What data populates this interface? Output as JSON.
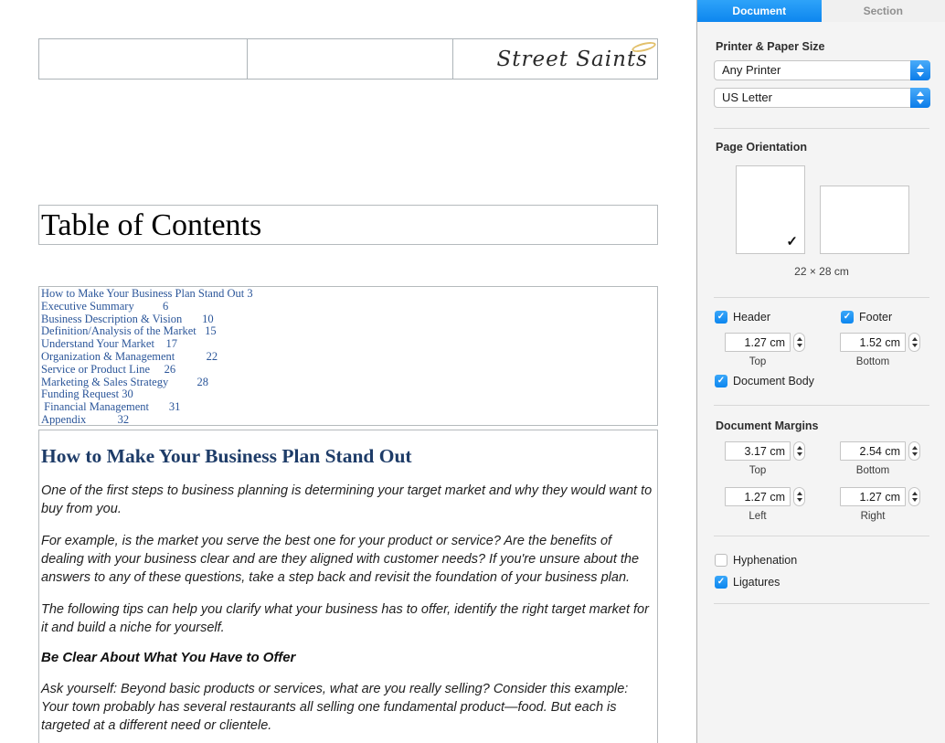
{
  "colors": {
    "accent_blue": "#1b96f5",
    "toc_link_blue": "#2a5599",
    "heading_navy": "#1e3c68",
    "halo_gold": "#e2c06b",
    "sidebar_bg": "#f4f4f4"
  },
  "document": {
    "header": {
      "logo_text": "Street Saints"
    },
    "title": "Table of Contents",
    "toc": {
      "entries": [
        {
          "title": "How to Make Your Business Plan Stand Out",
          "page": "3",
          "line": "How to Make Your Business Plan Stand Out 3"
        },
        {
          "title": "Executive Summary",
          "page": "6",
          "line": "Executive Summary          6"
        },
        {
          "title": "Business Description & Vision",
          "page": "10",
          "line": "Business Description & Vision       10"
        },
        {
          "title": "Definition/Analysis of the Market",
          "page": "15",
          "line": "Definition/Analysis of the Market   15"
        },
        {
          "title": "Understand Your Market",
          "page": "17",
          "line": "Understand Your Market    17"
        },
        {
          "title": "Organization & Management",
          "page": "22",
          "line": "Organization & Management           22"
        },
        {
          "title": "Service or Product Line",
          "page": "26",
          "line": "Service or Product Line     26"
        },
        {
          "title": "Marketing & Sales Strategy",
          "page": "28",
          "line": "Marketing & Sales Strategy          28"
        },
        {
          "title": "Funding Request",
          "page": "30",
          "line": "Funding Request 30"
        },
        {
          "title": "Financial Management",
          "page": "31",
          "line": " Financial Management       31"
        },
        {
          "title": "Appendix",
          "page": "32",
          "line": "Appendix           32"
        }
      ]
    },
    "article": {
      "heading": "How to Make Your Business Plan Stand Out",
      "paragraphs": [
        "One of the first steps to business planning is determining your target market and why they would want to buy from you.",
        "For example, is the market you serve the best one for your product or service? Are the benefits of dealing with your business clear and are they aligned with customer needs? If you're unsure about the answers to any of these questions, take a step back and revisit the foundation of your business plan.",
        "The following tips can help you clarify what your business has to offer, identify the right target market for it and build a niche for yourself."
      ],
      "subheading": "Be Clear About What You Have to Offer",
      "closing_paragraph": "Ask yourself: Beyond basic products or services, what are you really selling? Consider this example: Your town probably has several restaurants all selling one fundamental product—food. But each is targeted at a different need or clientele."
    }
  },
  "inspector": {
    "check_glyph": "✓",
    "tabs": {
      "document_label": "Document",
      "document_active": true,
      "section_label": "Section",
      "section_active": false
    },
    "printer_section": {
      "heading": "Printer & Paper Size",
      "printer_value": "Any Printer",
      "paper_value": "US Letter"
    },
    "orientation_section": {
      "heading": "Page Orientation",
      "portrait_selected": true,
      "checkmark": "✓",
      "page_size": "22 × 28 cm"
    },
    "header_footer": {
      "header_label": "Header",
      "header_checked": true,
      "header_value": "1.27 cm",
      "header_field_label": "Top",
      "footer_label": "Footer",
      "footer_checked": true,
      "footer_value": "1.52 cm",
      "footer_field_label": "Bottom",
      "document_body_label": "Document Body",
      "document_body_checked": true
    },
    "margins_section": {
      "heading": "Document Margins",
      "fields": [
        {
          "value": "3.17 cm",
          "label": "Top"
        },
        {
          "value": "2.54 cm",
          "label": "Bottom"
        },
        {
          "value": "1.27 cm",
          "label": "Left"
        },
        {
          "value": "1.27 cm",
          "label": "Right"
        }
      ]
    },
    "typography_options": {
      "hyphenation_label": "Hyphenation",
      "hyphenation_checked": false,
      "ligatures_label": "Ligatures",
      "ligatures_checked": true
    }
  }
}
